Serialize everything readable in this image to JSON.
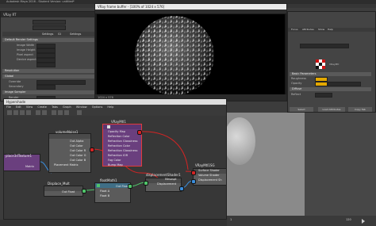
{
  "app": {
    "title": "Autodesk Maya 2016 - Student Version: untitled*",
    "menus": [
      "File",
      "Edit",
      "Create",
      "Select",
      "Modify",
      "Display",
      "Windows"
    ],
    "workspace": "Maya Classic"
  },
  "left_panel": {
    "title": "VRay RT",
    "tabs": [
      "Settings",
      "GI",
      "Settings"
    ],
    "sections": [
      {
        "label": "Default Render Settings",
        "rows": [
          {
            "label": "Image Width",
            "value": "1920"
          },
          {
            "label": "Image Height",
            "value": "1080"
          },
          {
            "label": "Pixel aspect",
            "value": "1.000"
          },
          {
            "label": "Device aspect",
            "value": "1.778"
          }
        ]
      },
      {
        "label": "Resolution",
        "rows": []
      },
      {
        "label": "Global",
        "rows": [
          {
            "label": "Override",
            "value": "0"
          },
          {
            "label": "Secondary",
            "value": "1.000"
          }
        ]
      },
      {
        "label": "Image Sampler",
        "rows": []
      }
    ],
    "lower_rows": [
      "Render",
      "Sampler type",
      "Min subdivs",
      "Max subdivs",
      "Threshold"
    ]
  },
  "framebuffer": {
    "title": "VRay frame buffer - [100% of 1024 x 576]",
    "status": "1024 x 576"
  },
  "right_panel": {
    "tabs": [
      "Focus",
      "Attributes",
      "Show",
      "Help"
    ],
    "swatch_name": "VRayMtl",
    "sections": [
      "Basic Parameters",
      "Diffuse",
      "Reflection"
    ],
    "fields": [
      {
        "label": "Roughness",
        "value": "0.000"
      },
      {
        "label": "Opacity",
        "value": "1.000"
      },
      {
        "label": "Reflect",
        "value": "0.000"
      }
    ],
    "buttons": [
      "Select",
      "Load Attributes",
      "Copy Tab"
    ]
  },
  "hypershade": {
    "title": "Hypershade",
    "menus": [
      "File",
      "Edit",
      "View",
      "Create",
      "Tabs",
      "Graph",
      "Window",
      "Options",
      "Help"
    ]
  },
  "nodes": {
    "noise": {
      "title": "volumeNoise1",
      "ports": [
        "Out Alpha",
        "Out Color",
        "Out Color R",
        "Out Color G",
        "Out Color B",
        "Placement Matrix"
      ]
    },
    "vraymtl": {
      "title": "VRayMtl1",
      "ports": [
        "Opacity Map",
        "Reflection Color",
        "Refraction Glossiness",
        "Refraction Color",
        "Refraction Glossiness",
        "Refraction IOR",
        "Fog Color",
        "Bump Map"
      ]
    },
    "texture3d": {
      "title": "place3dTexture1",
      "ports": [
        "Matrix"
      ]
    },
    "displace": {
      "title": "Displace_Mult",
      "ports": [
        "Out Float"
      ]
    },
    "floatmath": {
      "title": "floatMath1",
      "ports": [
        "Out Float",
        "Float A",
        "Float B"
      ]
    },
    "dispshader": {
      "title": "displacementShader1",
      "ports": [
        "Mesospt",
        "Displacement"
      ]
    },
    "sg": {
      "title": "VRayMtl1SG",
      "ports": [
        "Surface Shader",
        "Volume Shader",
        "Displacement Sh"
      ]
    }
  },
  "timeline": {
    "start": "1",
    "end": "120",
    "current": "1"
  },
  "colors": {
    "accent": "#e23a3a",
    "selected": "#6a3f7e",
    "connection_red": "#d42424",
    "connection_green": "#4fc46a",
    "connection_blue": "#3a8ddb"
  }
}
